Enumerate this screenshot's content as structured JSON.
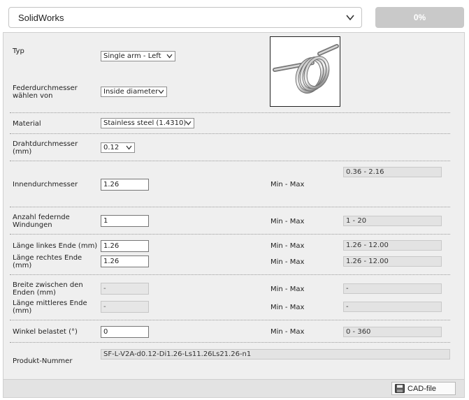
{
  "cad_format": {
    "selected": "SolidWorks"
  },
  "progress": {
    "value": 0,
    "text": "0%",
    "color": "#8aa5c4"
  },
  "form": {
    "typ": {
      "label": "Typ",
      "value": "Single arm - Left"
    },
    "federdurchmesser": {
      "label_line1": "Federdurchmesser",
      "label_line2": "wählen von",
      "value": "Inside diameter"
    },
    "material": {
      "label": "Material",
      "value": "Stainless steel (1.4310)"
    },
    "drahtdurchmesser": {
      "label_line1": "Drahtdurchmesser",
      "label_line2": "(mm)",
      "value": "0.12"
    },
    "innendurchmesser": {
      "label": "Innendurchmesser",
      "value": "1.26",
      "minmax_label": "Min - Max",
      "range": "0.36 - 2.16"
    },
    "windungen": {
      "label_line1": "Anzahl federnde",
      "label_line2": "Windungen",
      "value": "1",
      "minmax_label": "Min - Max",
      "range": "1 - 20"
    },
    "laenge_links": {
      "label": "Länge linkes Ende (mm)",
      "value": "1.26",
      "minmax_label": "Min - Max",
      "range": "1.26 - 12.00"
    },
    "laenge_rechts": {
      "label_line1": "Länge rechtes Ende",
      "label_line2": "(mm)",
      "value": "1.26",
      "minmax_label": "Min - Max",
      "range": "1.26 - 12.00"
    },
    "breite": {
      "label_line1": "Breite zwischen den",
      "label_line2": "Enden (mm)",
      "value": "-",
      "minmax_label": "Min - Max",
      "range": "-"
    },
    "laenge_mitte": {
      "label_line1": "Länge mittleres Ende",
      "label_line2": "(mm)",
      "value": "-",
      "minmax_label": "Min - Max",
      "range": "-"
    },
    "winkel": {
      "label": "Winkel belastet (°)",
      "value": "0",
      "minmax_label": "Min - Max",
      "range": "0 - 360"
    },
    "produktnummer": {
      "label": "Produkt-Nummer",
      "value": "SF-L-V2A-d0.12-Di1.26-Ls11.26Ls21.26-n1"
    }
  },
  "footer": {
    "cad_button_label": "CAD-file"
  },
  "icons": {
    "dropdown": "chevron-down-icon",
    "cad": "save-disk-icon",
    "preview": "torsion-spring-image"
  }
}
